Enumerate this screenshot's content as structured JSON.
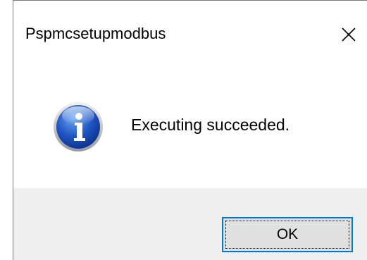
{
  "window": {
    "title": "Pspmcsetupmodbus",
    "close_icon": "close-icon"
  },
  "dialog": {
    "icon": "information-icon",
    "message": "Executing succeeded."
  },
  "buttons": {
    "ok_label": "OK"
  },
  "colors": {
    "footer_background": "#f0f0f0",
    "button_focus_border": "#0078d7",
    "icon_blue": "#1b4fb5"
  }
}
